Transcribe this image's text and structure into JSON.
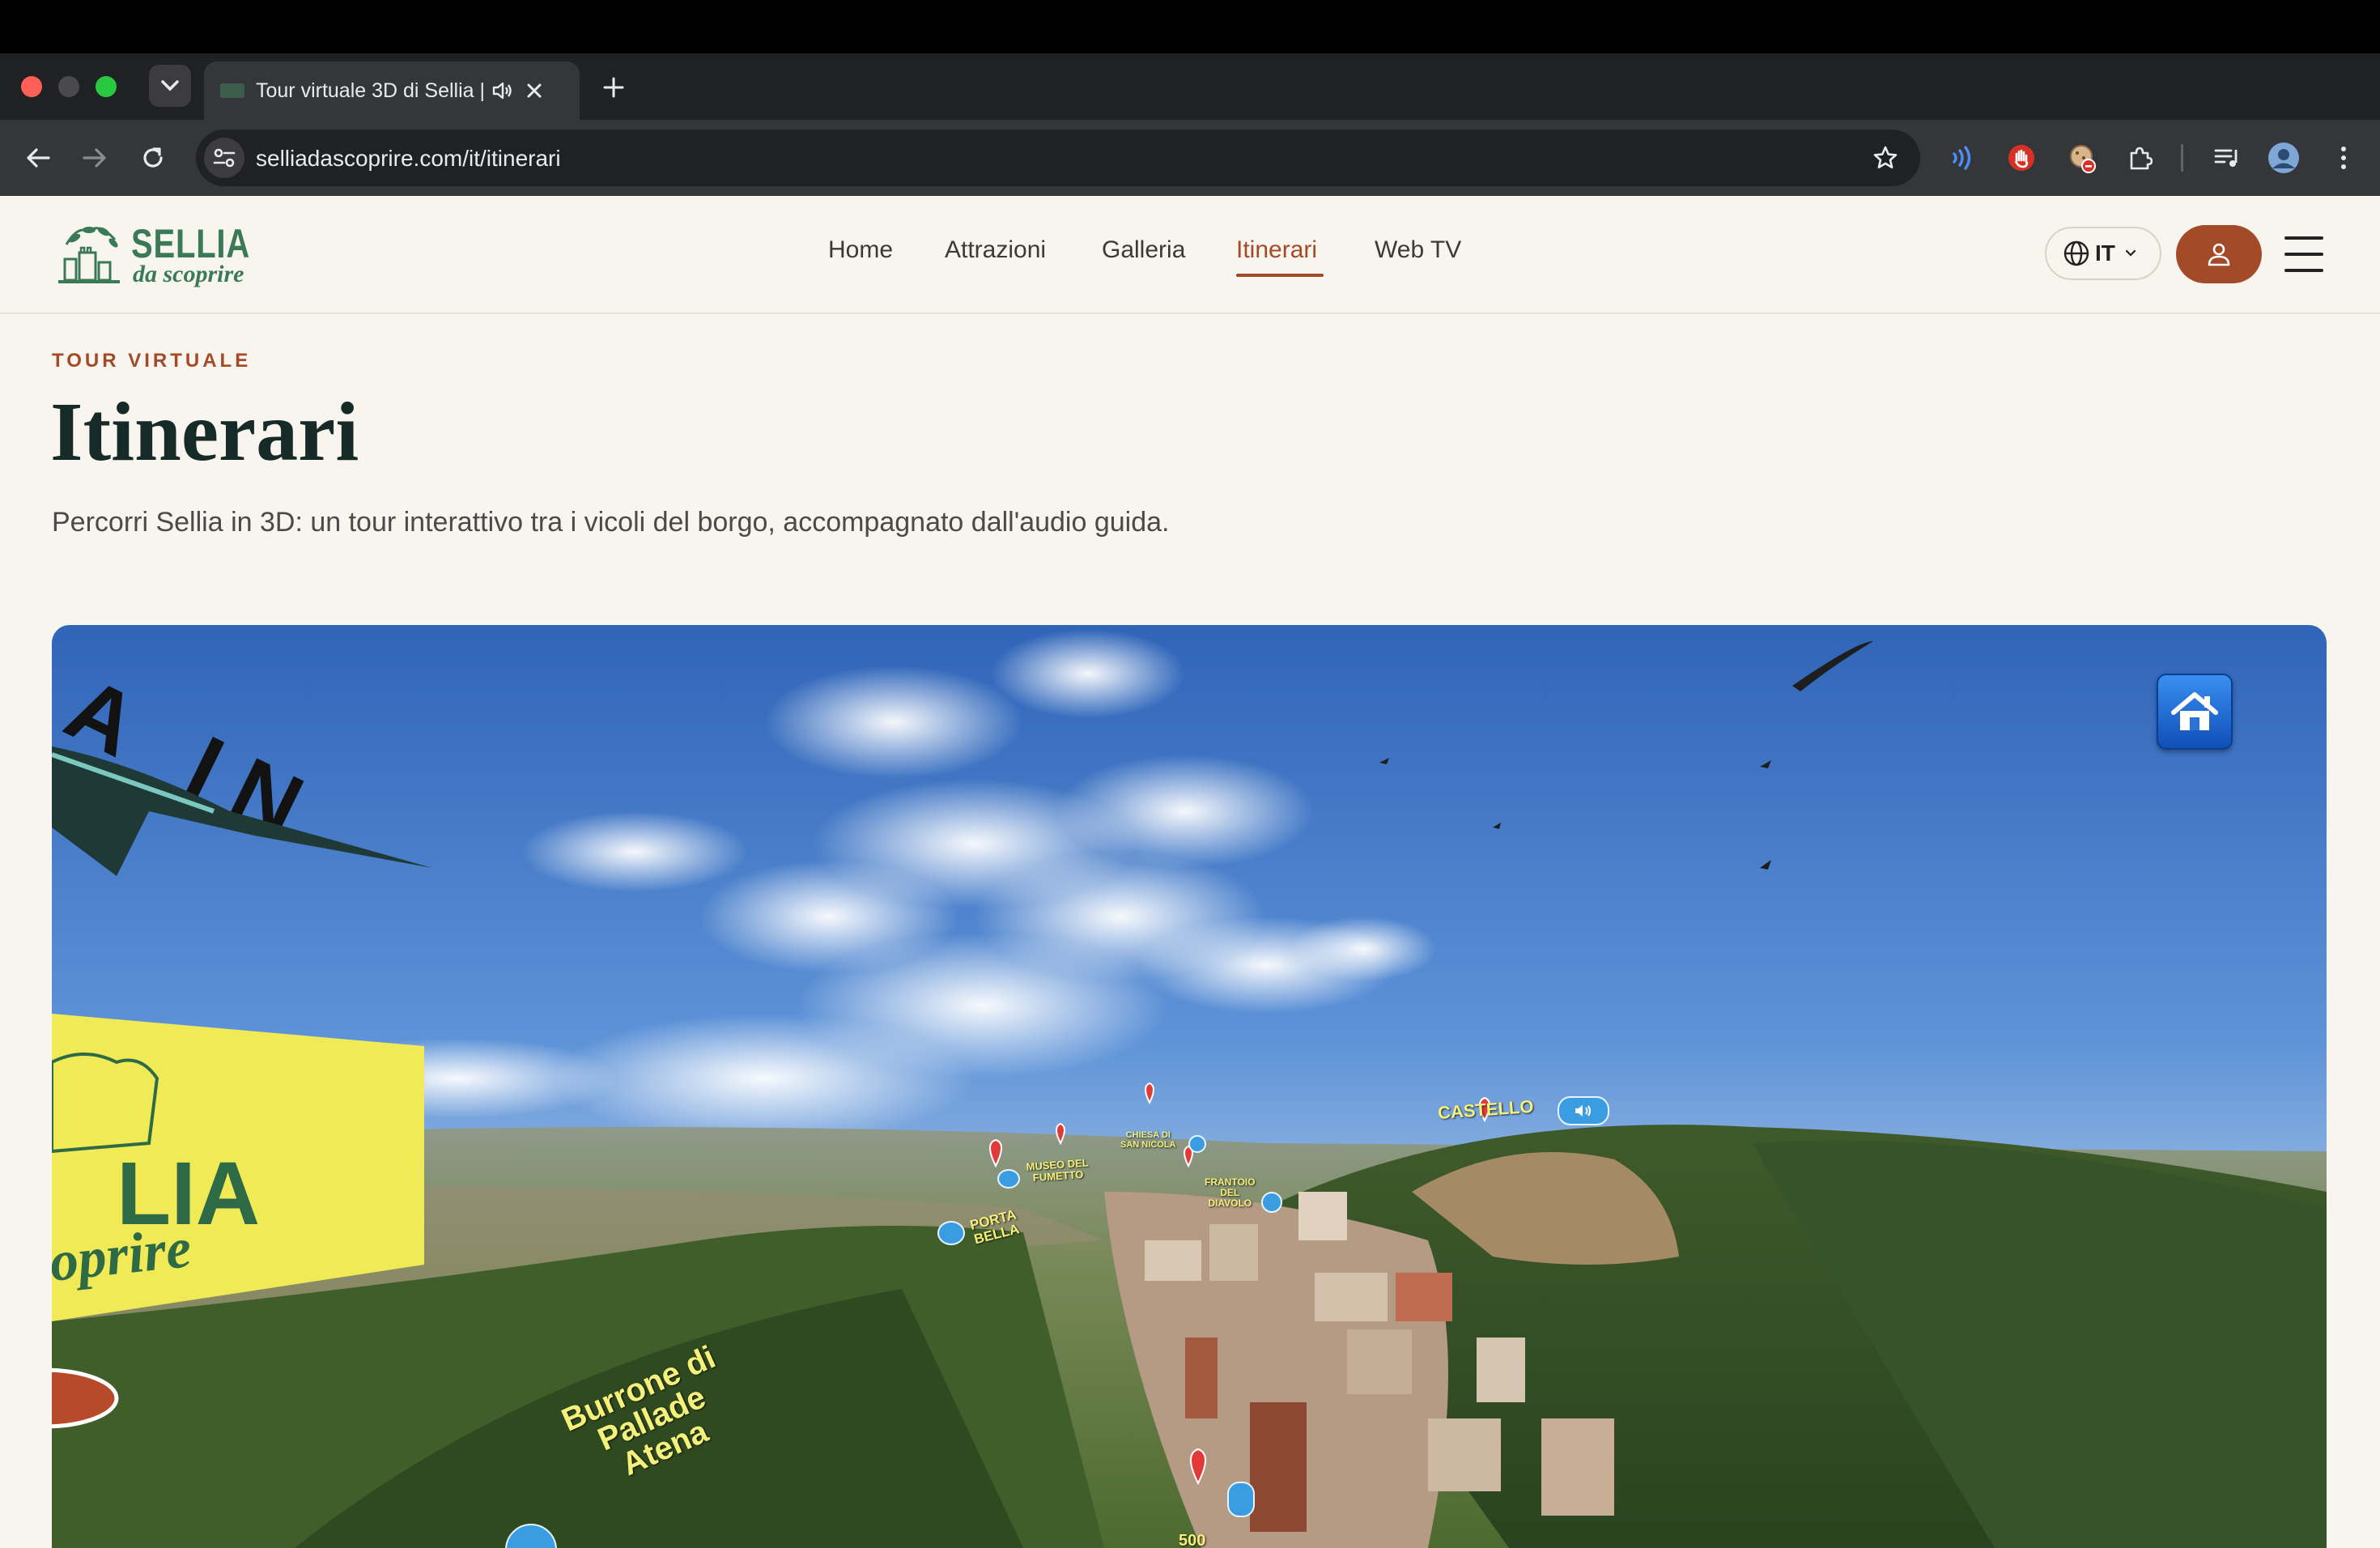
{
  "browser": {
    "tab_title": "Tour virtuale 3D di Sellia | ",
    "url": "selliadascoprire.com/it/itinerari"
  },
  "site": {
    "logo_line1": "SELLIA",
    "logo_line2": "da scoprire",
    "nav": [
      "Home",
      "Attrazioni",
      "Galleria",
      "Itinerari",
      "Web TV"
    ],
    "active_nav": "Itinerari",
    "language": "IT"
  },
  "hero": {
    "eyebrow": "TOUR VIRTUALE",
    "title": "Itinerari",
    "lead": "Percorri Sellia in 3D: un tour interattivo tra i vicoli del borgo, accompagnato dall'audio guida."
  },
  "tour": {
    "poi": {
      "castello": "CASTELLO",
      "chiesa_line1": "CHIESA DI",
      "chiesa_line2": "SAN NICOLA",
      "museo_line1": "MUSEO DEL",
      "museo_line2": "FUMETTO",
      "frantoio_line1": "FRANTOIO",
      "frantoio_line2": "DEL",
      "frantoio_line3": "DIAVOLO",
      "porta_line1": "PORTA",
      "porta_line2": "BELLA",
      "burrone_line1": "Burrone di",
      "burrone_line2": "Pallade",
      "burrone_line3": "Atena",
      "bottom_label": "500"
    },
    "sign_text1": "LIA",
    "sign_text2": "oprire",
    "banner_text": "A IN"
  }
}
